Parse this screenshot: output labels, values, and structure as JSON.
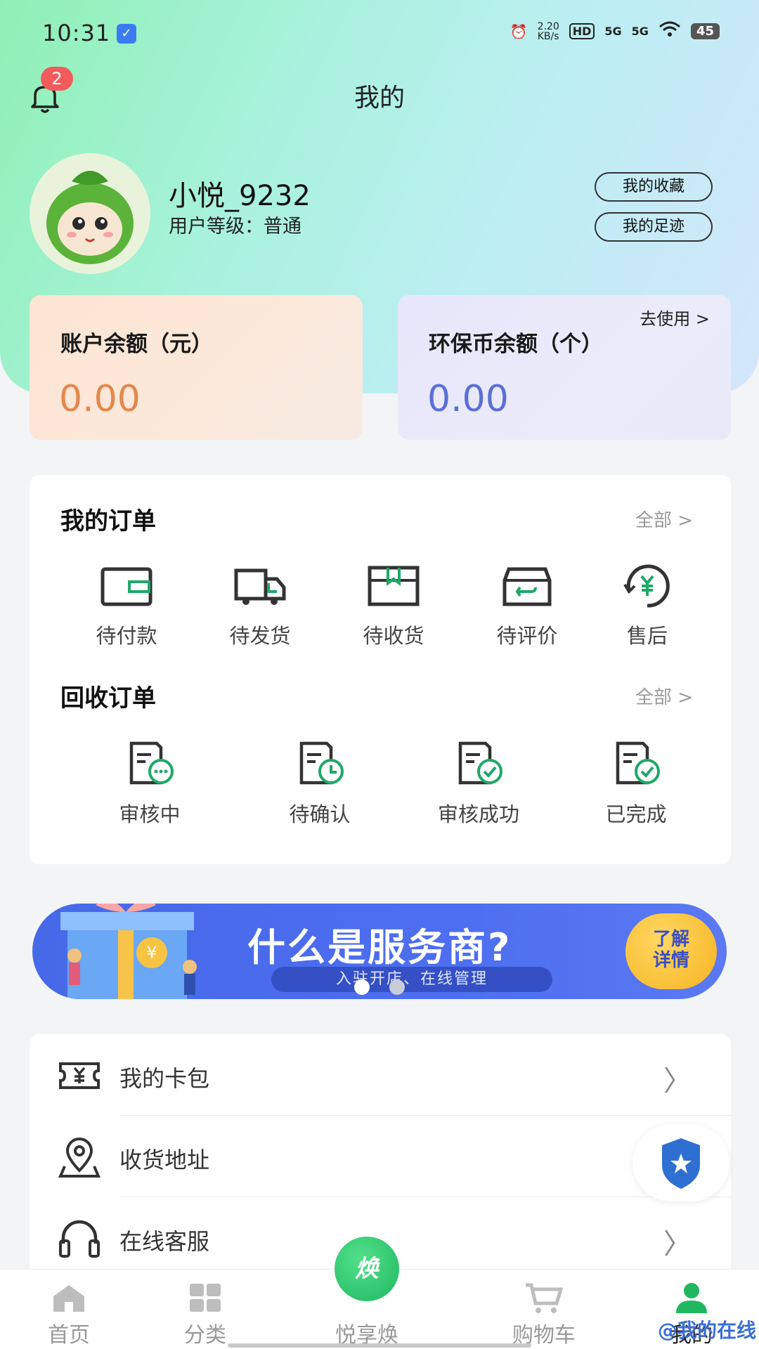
{
  "status_bar": {
    "time": "10:31",
    "network_speed_value": "2.20",
    "network_speed_unit": "KB/s",
    "hd": "HD",
    "signal_1": "5G",
    "signal_2": "5G",
    "battery": "45"
  },
  "header": {
    "title": "我的",
    "notification_count": "2"
  },
  "profile": {
    "username": "小悦_9232",
    "level_text": "用户等级：普通",
    "favorites_label": "我的收藏",
    "footprint_label": "我的足迹"
  },
  "balances": {
    "money": {
      "title": "账户余额（元）",
      "value": "0.00"
    },
    "eco": {
      "title": "环保币余额（个）",
      "value": "0.00",
      "use_label": "去使用 >"
    }
  },
  "orders": {
    "title": "我的订单",
    "more": "全部 >",
    "items": [
      {
        "label": "待付款",
        "icon": "wallet-icon"
      },
      {
        "label": "待发货",
        "icon": "truck-icon"
      },
      {
        "label": "待收货",
        "icon": "package-icon"
      },
      {
        "label": "待评价",
        "icon": "return-box-icon"
      },
      {
        "label": "售后",
        "icon": "yen-refund-icon"
      }
    ]
  },
  "recycle_orders": {
    "title": "回收订单",
    "more": "全部 >",
    "items": [
      {
        "label": "审核中",
        "icon": "doc-pending-icon"
      },
      {
        "label": "待确认",
        "icon": "doc-clock-icon"
      },
      {
        "label": "审核成功",
        "icon": "doc-check-icon"
      },
      {
        "label": "已完成",
        "icon": "doc-done-icon"
      }
    ]
  },
  "banner": {
    "title": "什么是服务商?",
    "subtitle": "入驻开店、在线管理",
    "button_line1": "了解",
    "button_line2": "详情",
    "slide_count": 2,
    "active_slide": 1
  },
  "menu": {
    "items": [
      {
        "label": "我的卡包",
        "icon": "card-wallet-icon"
      },
      {
        "label": "收货地址",
        "icon": "location-pin-icon"
      },
      {
        "label": "在线客服",
        "icon": "headset-icon"
      }
    ]
  },
  "bottom_nav": {
    "items": [
      {
        "label": "首页",
        "icon": "home-icon"
      },
      {
        "label": "分类",
        "icon": "grid-icon"
      },
      {
        "label": "悦享焕",
        "icon": "exchange-icon"
      },
      {
        "label": "购物车",
        "icon": "cart-icon"
      },
      {
        "label": "我的",
        "icon": "user-icon"
      }
    ],
    "center_button_text": "焕",
    "active_index": 4
  },
  "watermark": "@我的在线",
  "colors": {
    "accent_green": "#1fb860",
    "money_orange": "#e4884c",
    "eco_blue": "#5a6fd6",
    "badge_red": "#f25b5b",
    "banner_blue": "#4669e8"
  }
}
